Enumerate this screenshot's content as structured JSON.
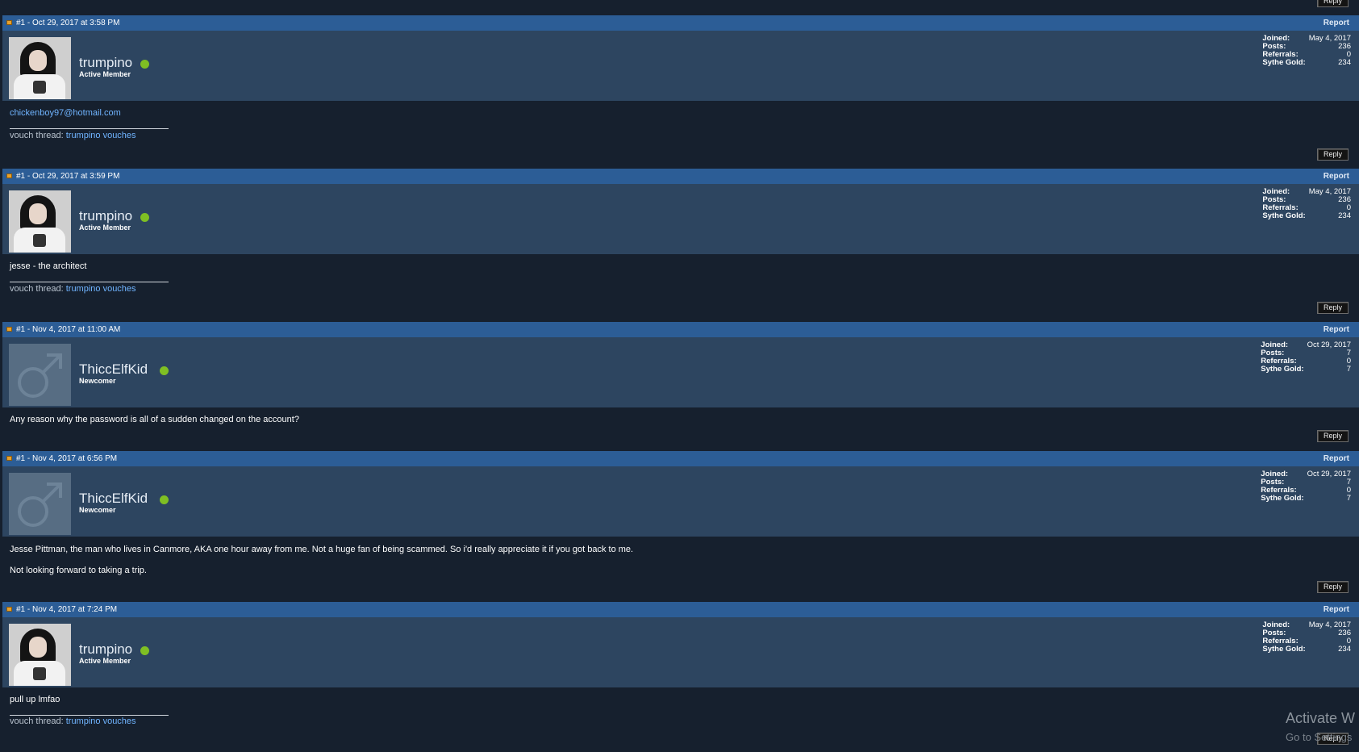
{
  "top_reply_label": "Reply",
  "posts": [
    {
      "header": "#1 - Oct 29, 2017 at 3:58 PM",
      "report": "Report",
      "username": "trumpino",
      "usertitle": "Active Member",
      "stats": {
        "joined_label": "Joined:",
        "joined": "May 4, 2017",
        "posts_label": "Posts:",
        "posts": "236",
        "referrals_label": "Referrals:",
        "referrals": "0",
        "gold_label": "Sythe Gold:",
        "gold": "234"
      },
      "lines": [
        "chickenboy97@hotmail.com"
      ],
      "sig_label": "vouch thread:",
      "sig_link": "trumpino vouches",
      "reply": "Reply"
    },
    {
      "header": "#1 - Oct 29, 2017 at 3:59 PM",
      "report": "Report",
      "username": "trumpino",
      "usertitle": "Active Member",
      "stats": {
        "joined_label": "Joined:",
        "joined": "May 4, 2017",
        "posts_label": "Posts:",
        "posts": "236",
        "referrals_label": "Referrals:",
        "referrals": "0",
        "gold_label": "Sythe Gold:",
        "gold": "234"
      },
      "lines": [
        "jesse - the architect"
      ],
      "sig_label": "vouch thread:",
      "sig_link": "trumpino vouches",
      "reply": "Reply"
    },
    {
      "header": "#1 - Nov 4, 2017 at 11:00 AM",
      "report": "Report",
      "username": "ThiccElfKid",
      "usertitle": "Newcomer",
      "stats": {
        "joined_label": "Joined:",
        "joined": "Oct 29, 2017",
        "posts_label": "Posts:",
        "posts": "7",
        "referrals_label": "Referrals:",
        "referrals": "0",
        "gold_label": "Sythe Gold:",
        "gold": "7"
      },
      "lines": [
        "Any reason why the password is all of a sudden changed on the account?"
      ],
      "reply": "Reply"
    },
    {
      "header": "#1 - Nov 4, 2017 at 6:56 PM",
      "report": "Report",
      "username": "ThiccElfKid",
      "usertitle": "Newcomer",
      "stats": {
        "joined_label": "Joined:",
        "joined": "Oct 29, 2017",
        "posts_label": "Posts:",
        "posts": "7",
        "referrals_label": "Referrals:",
        "referrals": "0",
        "gold_label": "Sythe Gold:",
        "gold": "7"
      },
      "lines": [
        "Jesse Pittman, the man who lives in Canmore, AKA one hour away from me. Not a huge fan of being scammed. So i'd really appreciate it if you got back to me.",
        "Not looking forward to taking a trip."
      ],
      "reply": "Reply"
    },
    {
      "header": "#1 - Nov 4, 2017 at 7:24 PM",
      "report": "Report",
      "username": "trumpino",
      "usertitle": "Active Member",
      "stats": {
        "joined_label": "Joined:",
        "joined": "May 4, 2017",
        "posts_label": "Posts:",
        "posts": "236",
        "referrals_label": "Referrals:",
        "referrals": "0",
        "gold_label": "Sythe Gold:",
        "gold": "234"
      },
      "lines": [
        "pull up lmfao"
      ],
      "sig_label": "vouch thread:",
      "sig_link": "trumpino vouches",
      "reply": "Reply"
    }
  ],
  "watermark": {
    "line1": "Activate W",
    "line2": "Go to Settings"
  }
}
